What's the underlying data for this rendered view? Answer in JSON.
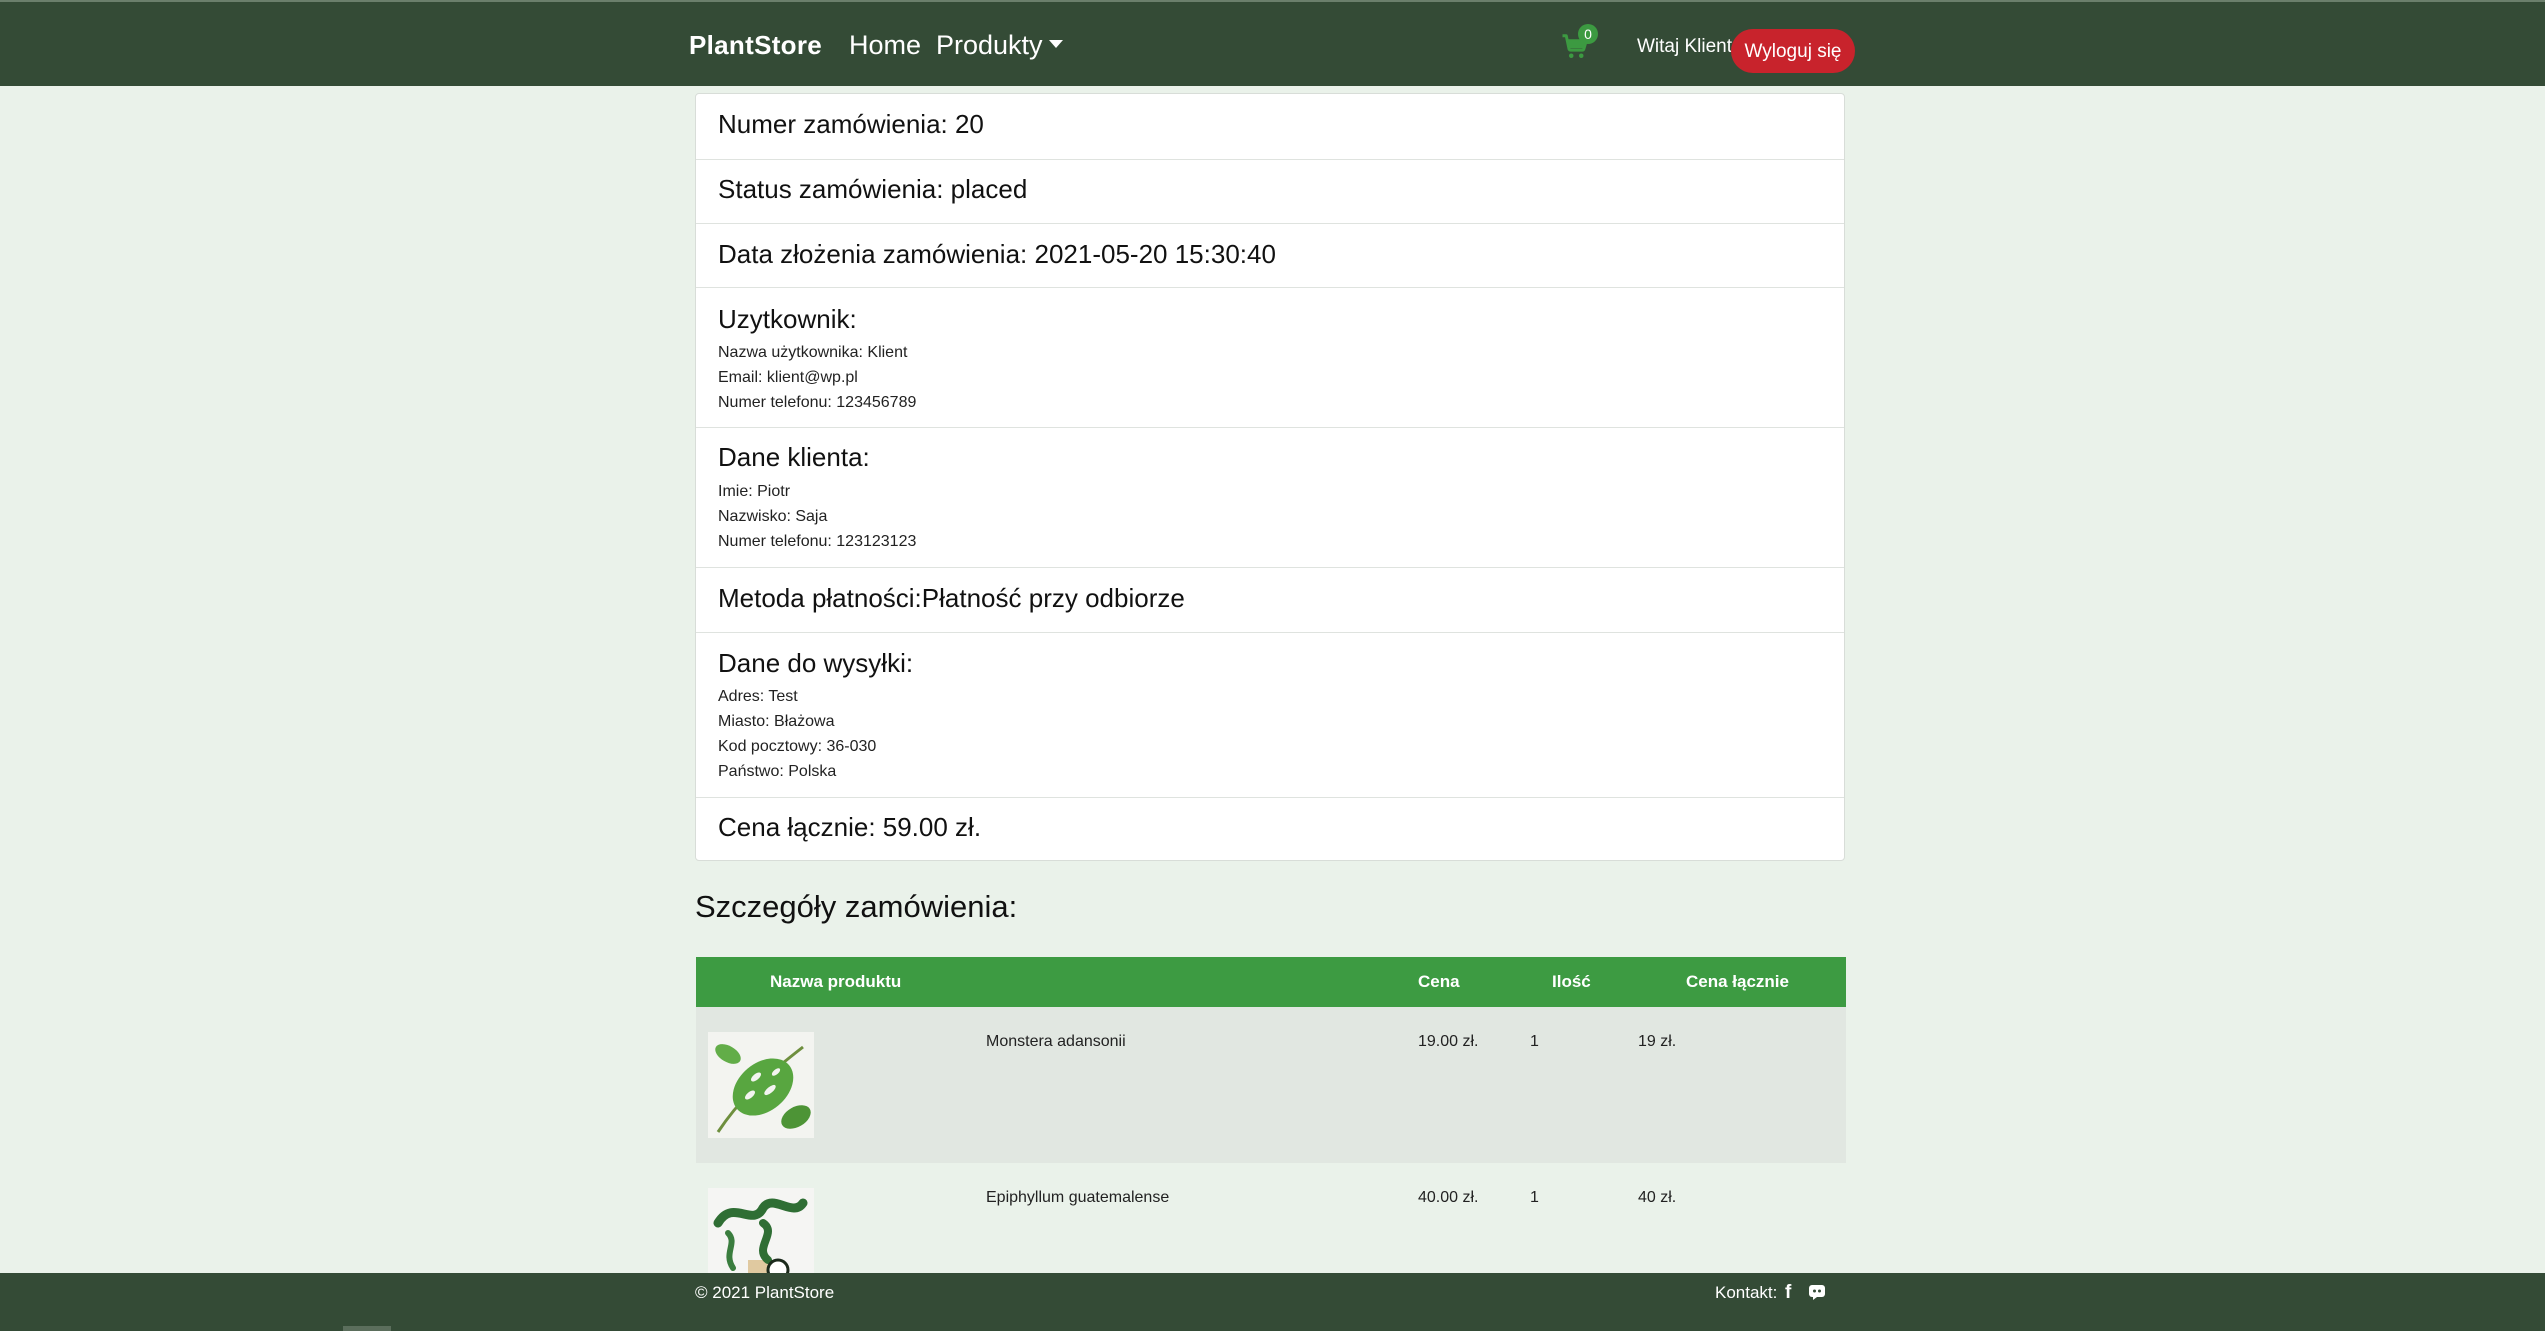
{
  "nav": {
    "brand": "PlantStore",
    "home": "Home",
    "products": "Produkty",
    "cart_count": "0",
    "welcome": "Witaj Klient",
    "logout": "Wyloguj się"
  },
  "order": {
    "number": "Numer zamówienia: 20",
    "status": "Status zamówienia: placed",
    "date": "Data złożenia zamówienia: 2021-05-20 15:30:40",
    "user_heading": "Uzytkownik:",
    "user_lines": [
      "Nazwa użytkownika: Klient",
      "Email: klient@wp.pl",
      "Numer telefonu: 123456789"
    ],
    "client_heading": "Dane klienta:",
    "client_lines": [
      "Imie: Piotr",
      "Nazwisko: Saja",
      "Numer telefonu: 123123123"
    ],
    "payment": "Metoda płatności:Płatność przy odbiorze",
    "shipping_heading": "Dane do wysyłki:",
    "shipping_lines": [
      "Adres: Test",
      "Miasto: Błażowa",
      "Kod pocztowy: 36-030",
      "Państwo: Polska"
    ],
    "total": "Cena łącznie: 59.00 zł."
  },
  "details": {
    "title": "Szczegóły zamówienia:",
    "headers": [
      "Nazwa produktu",
      "Cena",
      "Ilość",
      "Cena łącznie"
    ],
    "rows": [
      {
        "name": "Monstera adansonii",
        "price": "19.00 zł.",
        "qty": "1",
        "total": "19 zł."
      },
      {
        "name": "Epiphyllum guatemalense",
        "price": "40.00 zł.",
        "qty": "1",
        "total": "40 zł."
      }
    ]
  },
  "footer": {
    "copyright": "© 2021 PlantStore",
    "contact": "Kontakt:"
  },
  "colors": {
    "navbar": "#344b36",
    "accent_green": "#3d9b42",
    "logout_red": "#c8232c",
    "page_bg": "#eaf2ea"
  },
  "icons": [
    "cart-icon",
    "caret-down-icon",
    "facebook-icon",
    "discord-icon"
  ]
}
